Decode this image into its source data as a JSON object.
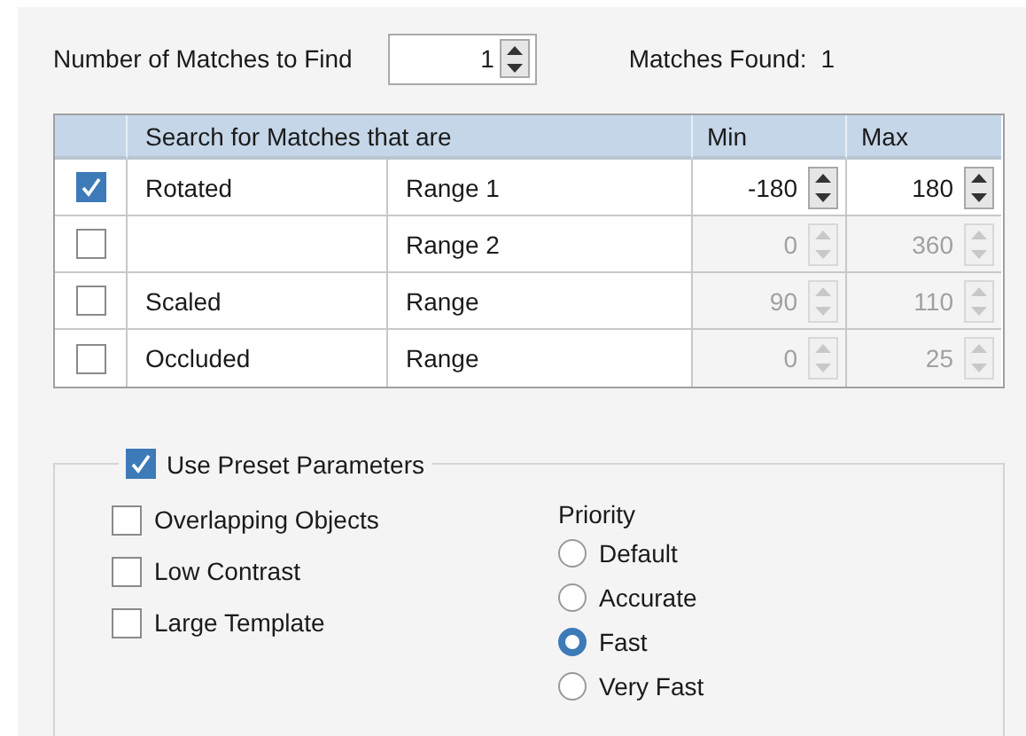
{
  "matches_to_find": {
    "label": "Number of Matches to Find",
    "value": "1"
  },
  "matches_found": {
    "label": "Matches Found:",
    "value": "1"
  },
  "table": {
    "columns": [
      "Search for Matches that are",
      "Min",
      "Max"
    ],
    "rows": [
      {
        "checked": true,
        "type": "Rotated",
        "range": "Range 1",
        "min": "-180",
        "max": "180"
      },
      {
        "checked": false,
        "type": "",
        "range": "Range 2",
        "min": "0",
        "max": "360"
      },
      {
        "checked": false,
        "type": "Scaled",
        "range": "Range",
        "min": "90",
        "max": "110"
      },
      {
        "checked": false,
        "type": "Occluded",
        "range": "Range",
        "min": "0",
        "max": "25"
      }
    ]
  },
  "preset": {
    "label": "Use Preset Parameters",
    "checked": true,
    "options": [
      {
        "label": "Overlapping Objects",
        "checked": false
      },
      {
        "label": "Low Contrast",
        "checked": false
      },
      {
        "label": "Large Template",
        "checked": false
      }
    ],
    "priority": {
      "label": "Priority",
      "choices": [
        {
          "label": "Default",
          "selected": false
        },
        {
          "label": "Accurate",
          "selected": false
        },
        {
          "label": "Fast",
          "selected": true
        },
        {
          "label": "Very Fast",
          "selected": false
        }
      ]
    }
  }
}
